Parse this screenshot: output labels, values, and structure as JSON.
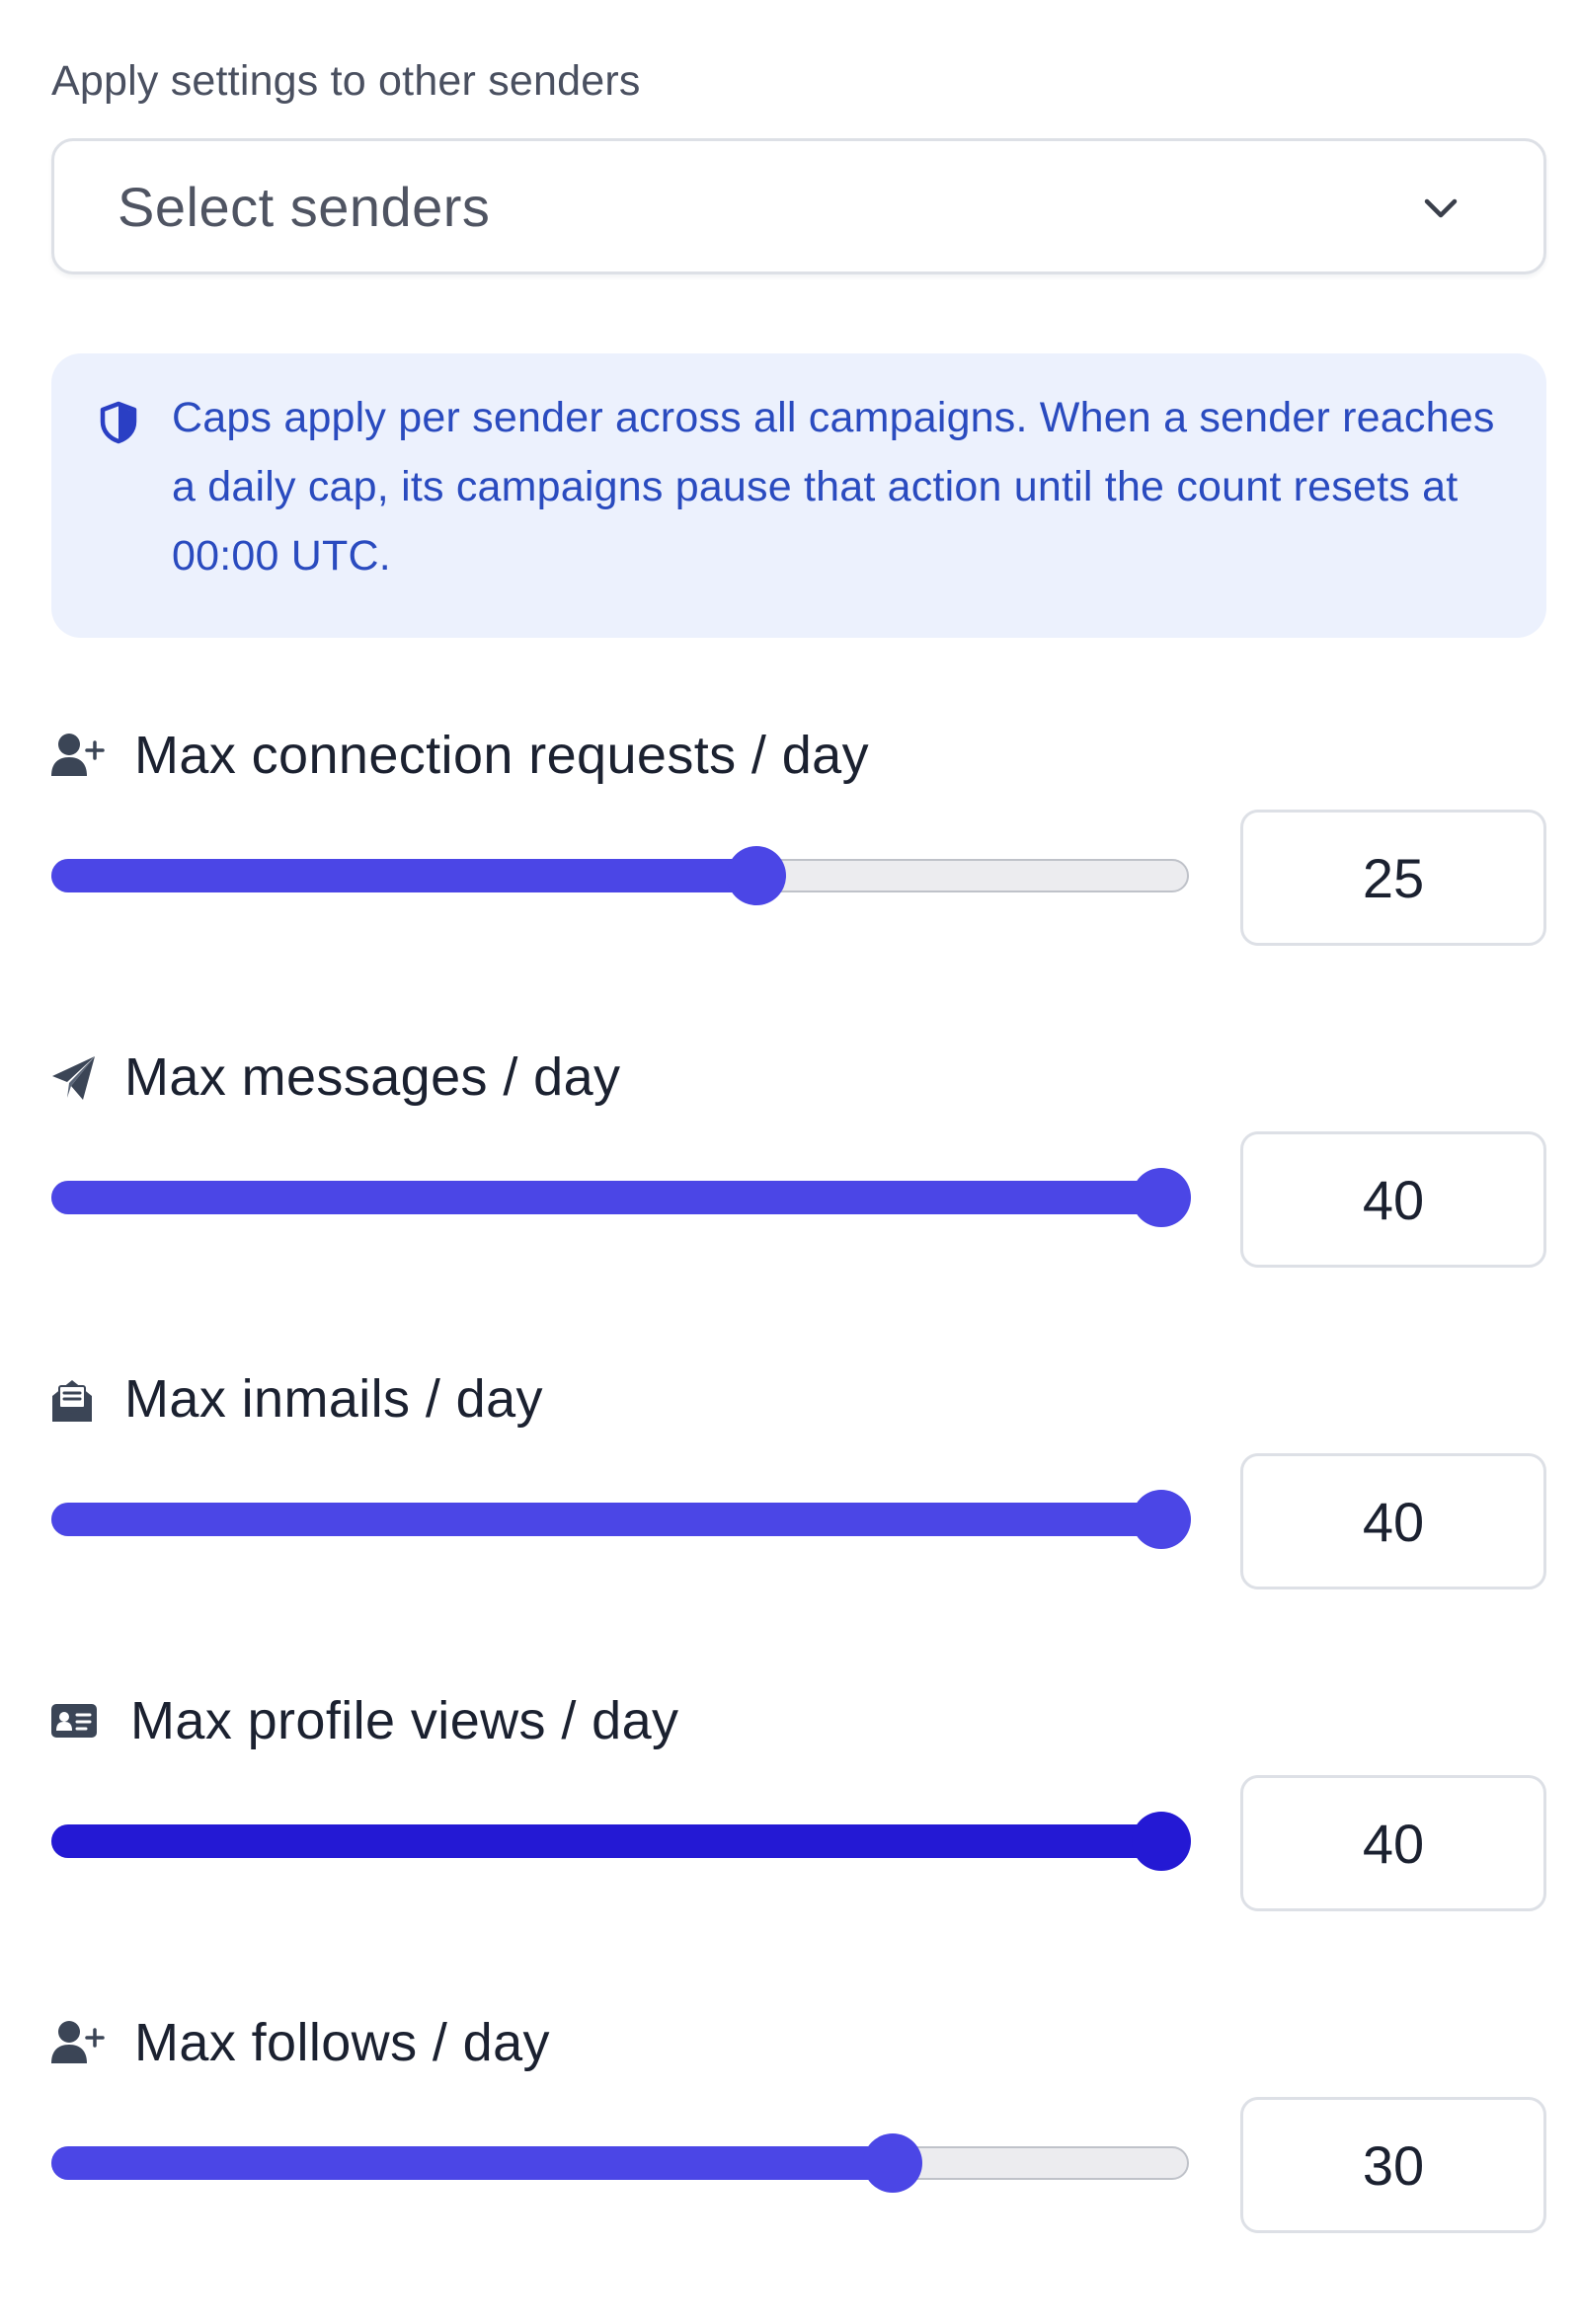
{
  "apply": {
    "label": "Apply settings to other senders",
    "placeholder": "Select senders"
  },
  "info": {
    "icon": "shield-icon",
    "text": "Caps apply per sender across all campaigns. When a sender reaches a daily cap, its campaigns pause that action until the count resets at 00:00 UTC."
  },
  "colors": {
    "accent": "#4b46e6",
    "accent_active": "#2419d4",
    "info_bg": "#ecf1fd",
    "info_text": "#2a4bbf"
  },
  "settings": [
    {
      "icon": "user-plus-icon",
      "label": "Max connection requests / day",
      "value": "25",
      "fill_fraction": 0.62
    },
    {
      "icon": "paper-plane-icon",
      "label": "Max messages / day",
      "value": "40",
      "fill_fraction": 1.0
    },
    {
      "icon": "envelope-open-icon",
      "label": "Max inmails / day",
      "value": "40",
      "fill_fraction": 1.0
    },
    {
      "icon": "id-card-icon",
      "label": "Max profile views / day",
      "value": "40",
      "fill_fraction": 1.0,
      "active": true
    },
    {
      "icon": "user-plus-icon",
      "label": "Max follows / day",
      "value": "30",
      "fill_fraction": 0.74
    }
  ]
}
